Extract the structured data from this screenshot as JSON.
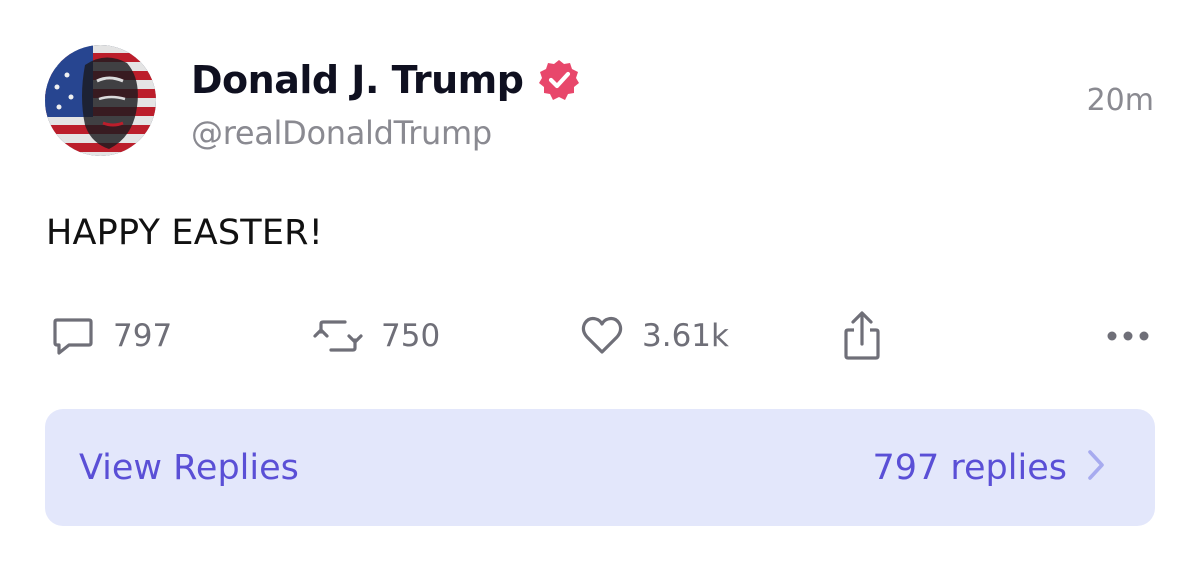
{
  "post": {
    "author": {
      "display_name": "Donald J. Trump",
      "handle": "@realDonaldTrump",
      "verified_icon": "verified-badge-icon",
      "verified_color": "#e8476b"
    },
    "timestamp": "20m",
    "text": "HAPPY EASTER!",
    "actions": {
      "replies": {
        "icon": "comment-icon",
        "count": "797"
      },
      "reposts": {
        "icon": "repost-icon",
        "count": "750"
      },
      "likes": {
        "icon": "heart-icon",
        "count": "3.61k"
      },
      "share": {
        "icon": "share-icon"
      },
      "more": {
        "icon": "more-options-icon"
      }
    }
  },
  "replies_bar": {
    "label": "View Replies",
    "count_text": "797 replies",
    "icon": "chevron-right-icon"
  },
  "colors": {
    "accent": "#5a4fd6",
    "replies_bar_bg": "#e3e7fb",
    "muted_text": "#8a8a91",
    "icon_gray": "#6f6f78"
  }
}
